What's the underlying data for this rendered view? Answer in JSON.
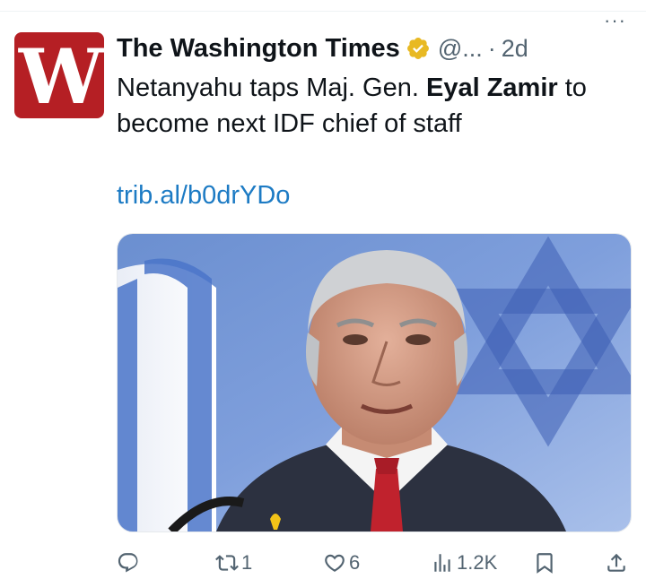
{
  "tweet": {
    "author_name": "The Washington Times",
    "avatar_letter": "W",
    "verified": true,
    "handle": "@...",
    "separator": "·",
    "time": "2d",
    "more_label": "···",
    "text_part1": "Netanyahu taps Maj. Gen. ",
    "text_bold": "Eyal Zamir",
    "text_part2": " to become next IDF chief of staff",
    "link": "trib.al/b0drYDo"
  },
  "actions": {
    "reply_count": "",
    "retweet_count": "1",
    "like_count": "6",
    "views_count": "1.2K"
  },
  "colors": {
    "brand_red": "#b51f24",
    "verified_gold": "#e8b923",
    "link_blue": "#1d7bc4",
    "muted_text": "#536471"
  },
  "icons": [
    "reply-icon",
    "retweet-icon",
    "like-icon",
    "views-icon",
    "bookmark-icon",
    "share-icon",
    "verified-badge-icon"
  ]
}
